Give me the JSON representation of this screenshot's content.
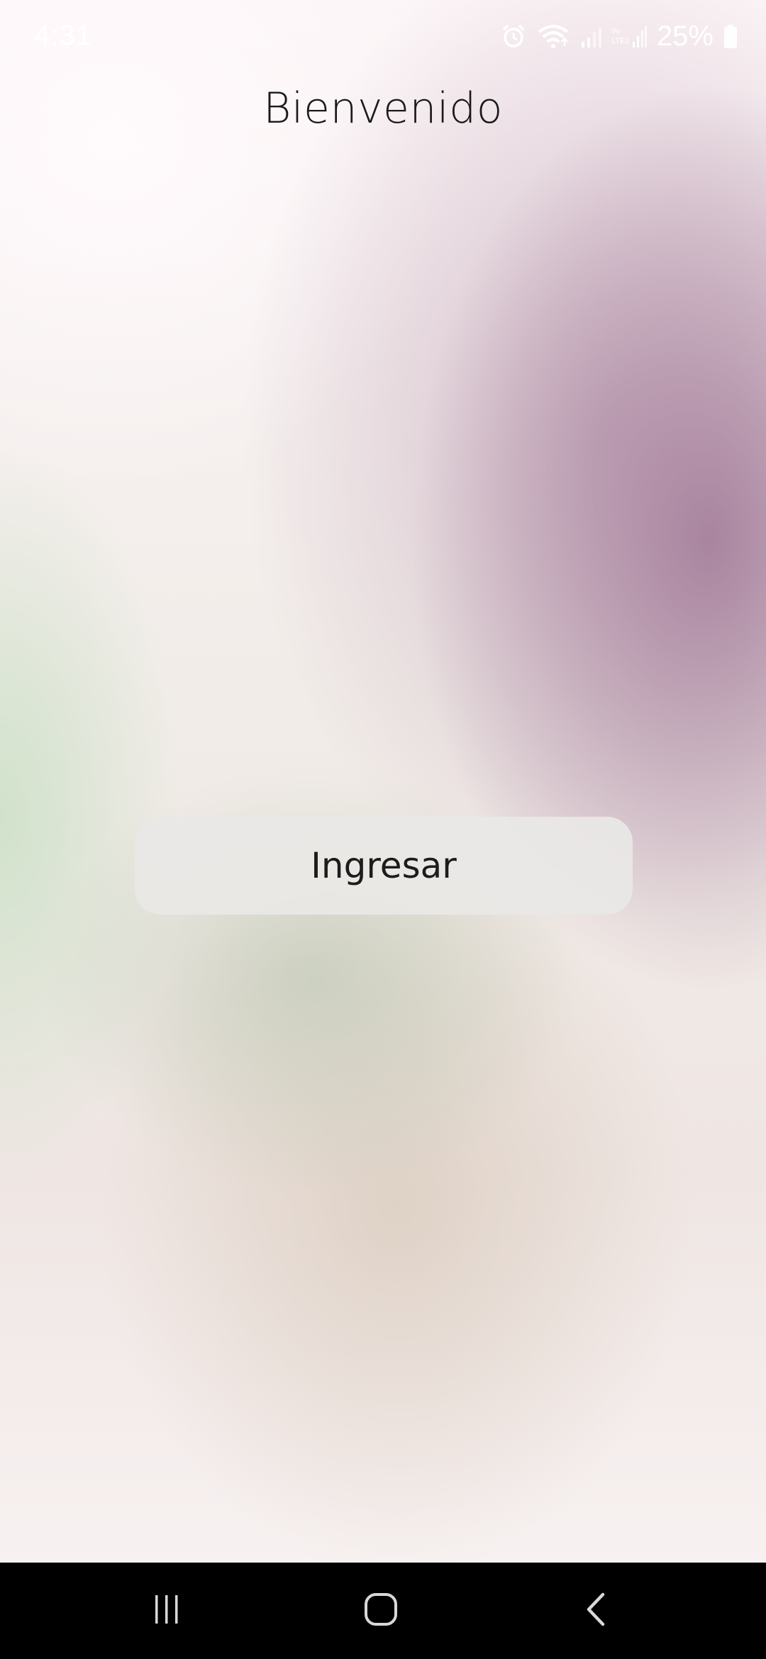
{
  "status_bar": {
    "time": "4:31",
    "battery_percent": "25%",
    "icons": [
      "alarm-icon",
      "wifi-icon",
      "signal-icon",
      "lte-signal-icon",
      "battery-icon"
    ]
  },
  "screen": {
    "title": "Bienvenido",
    "enter_button_label": "Ingresar"
  },
  "navigation_bar": {
    "buttons": [
      "recents-icon",
      "home-icon",
      "back-icon"
    ]
  },
  "colors": {
    "nav_bar_background": "#000000",
    "button_background": "#e9e8e6",
    "title_text": "#1a1a1a"
  }
}
